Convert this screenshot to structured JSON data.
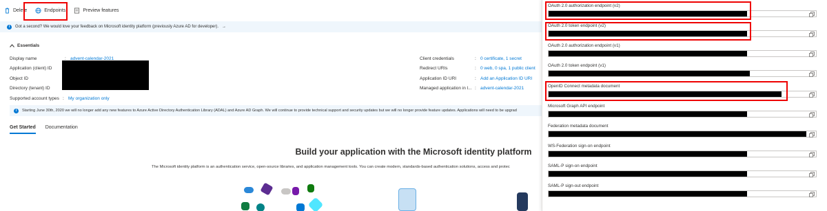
{
  "toolbar": {
    "delete_label": "Delete",
    "endpoints_label": "Endpoints",
    "preview_label": "Preview features"
  },
  "feedback": {
    "text": "Got a second? We would love your feedback on Microsoft identity platform (previously Azure AD for developer).",
    "arrow": "→"
  },
  "essentials": {
    "heading": "Essentials",
    "left": [
      {
        "label": "Display name",
        "value": "advent-calendar-2021",
        "link": true
      },
      {
        "label": "Application (client) ID",
        "value": "",
        "link": false
      },
      {
        "label": "Object ID",
        "value": "",
        "link": false
      },
      {
        "label": "Directory (tenant) ID",
        "value": "",
        "link": false
      },
      {
        "label": "Supported account types",
        "value": "My organization only",
        "link": true
      }
    ],
    "right": [
      {
        "label": "Client credentials",
        "value": "0 certificate, 1 secret"
      },
      {
        "label": "Redirect URIs",
        "value": "0 web, 0 spa, 1 public client"
      },
      {
        "label": "Application ID URI",
        "value": "Add an Application ID URI"
      },
      {
        "label": "Managed application in l...",
        "value": "advent-calendar-2021"
      }
    ]
  },
  "banner": {
    "text": "Starting June 30th, 2020 we will no longer add any new features to Azure Active Directory Authentication Library (ADAL) and Azure AD Graph. We will continue to provide technical support and security updates but we will no longer provide feature updates. Applications will need to be upgrad"
  },
  "tabs": [
    "Get Started",
    "Documentation"
  ],
  "hero": {
    "title": "Build your application with the Microsoft identity platform",
    "text": "The Microsoft identity platform is an authentication service, open-source libraries, and application management tools. You can create modern, standards-based authentication solutions, access and protec"
  },
  "endpoints": [
    {
      "label": "OAuth 2.0 authorization endpoint (v2)",
      "fill": 0.74,
      "highlight": true
    },
    {
      "label": "OAuth 2.0 token endpoint (v2)",
      "fill": 0.74,
      "highlight": true
    },
    {
      "label": "OAuth 2.0 authorization endpoint (v1)",
      "fill": 0.74,
      "highlight": false
    },
    {
      "label": "OAuth 2.0 token endpoint (v1)",
      "fill": 0.74,
      "highlight": false
    },
    {
      "label": "OpenID Connect metadata document",
      "fill": 0.87,
      "highlight": true
    },
    {
      "label": "Microsoft Graph API endpoint",
      "fill": 0.74,
      "highlight": false
    },
    {
      "label": "Federation metadata document",
      "fill": 0.96,
      "highlight": false
    },
    {
      "label": "WS-Federation sign-on endpoint",
      "fill": 0.74,
      "highlight": false
    },
    {
      "label": "SAML-P sign-on endpoint",
      "fill": 0.74,
      "highlight": false
    },
    {
      "label": "SAML-P sign-out endpoint",
      "fill": 0.74,
      "highlight": false
    }
  ],
  "colors": {
    "accent": "#0078d4",
    "highlight": "#e00000",
    "banner_bg": "#eff6fc"
  }
}
